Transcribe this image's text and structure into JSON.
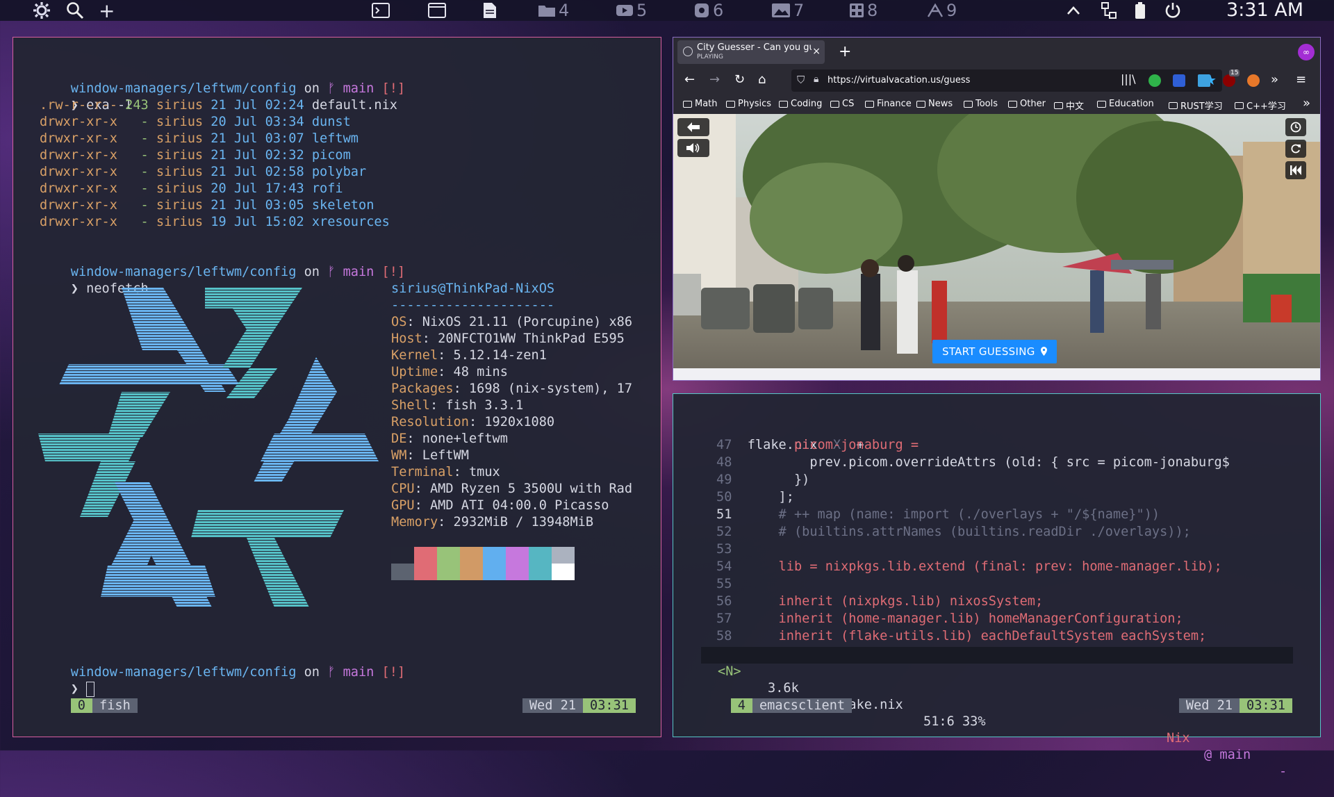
{
  "topbar": {
    "workspaces": [
      {
        "num": "4"
      },
      {
        "num": "5"
      },
      {
        "num": "6"
      },
      {
        "num": "7"
      },
      {
        "num": "8"
      },
      {
        "num": "9"
      }
    ],
    "clock": "3:31 AM"
  },
  "term_left": {
    "lines": [
      {
        "path": "window-managers/leftwm/config",
        "on": " on ",
        "branch_icon": "ᚠ",
        "branch": " main",
        "flag": " [!]"
      },
      {
        "prompt": "❯ ",
        "cmd": "exa -l"
      },
      {
        "perm": ".rw-r--r--",
        "size": " 243",
        "user": " sirius",
        "date": " 21 Jul 02:24",
        "name": " default.nix"
      },
      {
        "perm": "drwxr-xr-x",
        "size": "   -",
        "user": " sirius",
        "date": " 20 Jul 03:34",
        "name": " dunst"
      },
      {
        "perm": "drwxr-xr-x",
        "size": "   -",
        "user": " sirius",
        "date": " 21 Jul 03:07",
        "name": " leftwm"
      },
      {
        "perm": "drwxr-xr-x",
        "size": "   -",
        "user": " sirius",
        "date": " 21 Jul 02:32",
        "name": " picom"
      },
      {
        "perm": "drwxr-xr-x",
        "size": "   -",
        "user": " sirius",
        "date": " 21 Jul 02:58",
        "name": " polybar"
      },
      {
        "perm": "drwxr-xr-x",
        "size": "   -",
        "user": " sirius",
        "date": " 20 Jul 17:43",
        "name": " rofi"
      },
      {
        "perm": "drwxr-xr-x",
        "size": "   -",
        "user": " sirius",
        "date": " 21 Jul 03:05",
        "name": " skeleton"
      },
      {
        "perm": "drwxr-xr-x",
        "size": "   -",
        "user": " sirius",
        "date": " 19 Jul 15:02",
        "name": " xresources"
      },
      {
        "prompt": "❯ ",
        "cmd": "neofetch"
      }
    ],
    "neofetch": {
      "title": "sirius@ThinkPad-NixOS",
      "sep": "---------------------",
      "rows": [
        {
          "k": "OS",
          "v": ": NixOS 21.11 (Porcupine) x86"
        },
        {
          "k": "Host",
          "v": ": 20NFCTO1WW ThinkPad E595"
        },
        {
          "k": "Kernel",
          "v": ": 5.12.14-zen1"
        },
        {
          "k": "Uptime",
          "v": ": 48 mins"
        },
        {
          "k": "Packages",
          "v": ": 1698 (nix-system), 17"
        },
        {
          "k": "Shell",
          "v": ": fish 3.3.1"
        },
        {
          "k": "Resolution",
          "v": ": 1920x1080"
        },
        {
          "k": "DE",
          "v": ": none+leftwm"
        },
        {
          "k": "WM",
          "v": ": LeftWM"
        },
        {
          "k": "Terminal",
          "v": ": tmux"
        },
        {
          "k": "CPU",
          "v": ": AMD Ryzen 5 3500U with Rad"
        },
        {
          "k": "GPU",
          "v": ": AMD ATI 04:00.0 Picasso"
        },
        {
          "k": "Memory",
          "v": ": 2932MiB / 13948MiB"
        }
      ],
      "palette_top": [
        "#232534",
        "#e06c75",
        "#98c379",
        "#d19a66",
        "#61afef",
        "#c678dd",
        "#56b6c2",
        "#abb2bf"
      ],
      "palette_bottom": [
        "#5c6370",
        "#e06c75",
        "#98c379",
        "#d19a66",
        "#61afef",
        "#c678dd",
        "#56b6c2",
        "#ffffff"
      ]
    },
    "status": {
      "win": "0",
      "name": "fish",
      "day": "Wed 21",
      "time": "03:31"
    }
  },
  "firefox": {
    "tab_title": "City Guesser - Can you gues",
    "tab_sub": "PLAYING",
    "url": "https://virtualvacation.us/guess",
    "bookmarks": [
      "Math",
      "Physics",
      "Coding",
      "CS",
      "Finance",
      "News",
      "Tools",
      "Other",
      "中文",
      "Education",
      "RUST学习",
      "C++学习"
    ],
    "ext_badge": "15",
    "start_btn": "START GUESSING"
  },
  "emacs": {
    "tab": "flake.nix",
    "tab_close": "X",
    "tab_add": "+",
    "lines": [
      {
        "n": "47",
        "t": "      picom-jonaburg ="
      },
      {
        "n": "48",
        "t": "        prev.picom.overrideAttrs (old: { src = picom-jonaburg$"
      },
      {
        "n": "49",
        "t": "      })"
      },
      {
        "n": "50",
        "t": "    ];"
      },
      {
        "n": "51",
        "t": "    # ++ map (name: import (./overlays + \"/${name}\"))"
      },
      {
        "n": "52",
        "t": "    # (builtins.attrNames (builtins.readDir ./overlays));"
      },
      {
        "n": "53",
        "t": ""
      },
      {
        "n": "54",
        "t": "    lib = nixpkgs.lib.extend (final: prev: home-manager.lib);"
      },
      {
        "n": "55",
        "t": ""
      },
      {
        "n": "56",
        "t": "    inherit (nixpkgs.lib) nixosSystem;"
      },
      {
        "n": "57",
        "t": "    inherit (home-manager.lib) homeManagerConfiguration;"
      },
      {
        "n": "58",
        "t": "    inherit (flake-utils.lib) eachDefaultSystem eachSystem;"
      }
    ],
    "modeline": {
      "mode": "<N>",
      "size": "3.6k",
      "file": "flake.nix",
      "pos": "51:6 33%",
      "lang": "Nix",
      "branch": "@ main",
      "end": "-"
    },
    "status": {
      "win": "4",
      "name": "emacsclient",
      "day": "Wed 21",
      "time": "03:31"
    }
  }
}
